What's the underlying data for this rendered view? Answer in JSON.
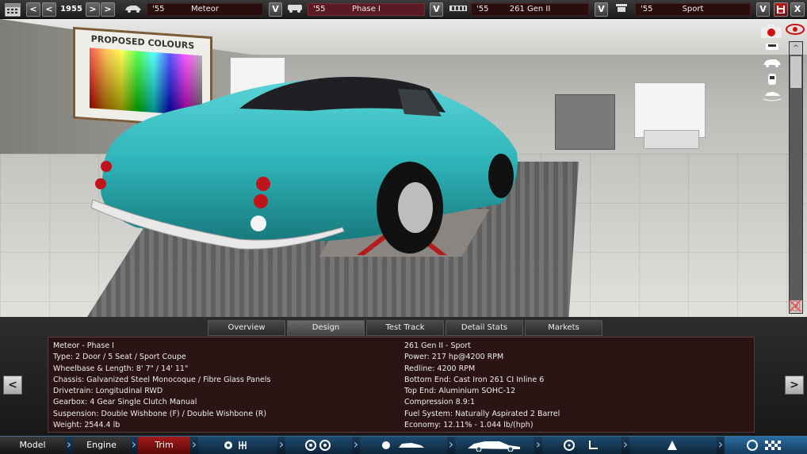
{
  "topbar": {
    "year": "1955",
    "prev_fast": "<",
    "prev": "<",
    "next": ">",
    "next_fast": ">",
    "selectors": [
      {
        "year": "'55",
        "name": "Meteor",
        "button": "V",
        "icon": "car-model-icon"
      },
      {
        "year": "'55",
        "name": "Phase I",
        "button": "V",
        "icon": "car-trim-icon"
      },
      {
        "year": "'55",
        "name": "261 Gen II",
        "button": "V",
        "icon": "engine-icon"
      },
      {
        "year": "'55",
        "name": "Sport",
        "button": "V",
        "icon": "trim-icon"
      }
    ],
    "save": "save-icon",
    "close": "X"
  },
  "scene": {
    "poster_title": "PROPOSED COLOURS",
    "car_color": "#2fb5b9",
    "scroll_up": "^",
    "scroll_down": "v"
  },
  "tabs": [
    {
      "label": "Overview",
      "active": false
    },
    {
      "label": "Design",
      "active": true
    },
    {
      "label": "Test Track",
      "active": false
    },
    {
      "label": "Detail Stats",
      "active": false
    },
    {
      "label": "Markets",
      "active": false
    }
  ],
  "info": {
    "left": [
      "Meteor - Phase I",
      "Type: 2 Door / 5 Seat / Sport Coupe",
      "Wheelbase & Length: 8' 7\" / 14' 11\"",
      "Chassis: Galvanized Steel Monocoque / Fibre Glass Panels",
      "Drivetrain: Longitudinal RWD",
      "Gearbox: 4 Gear Single Clutch Manual",
      "Suspension: Double Wishbone (F) / Double Wishbone (R)",
      "Weight: 2544.4 lb"
    ],
    "right": [
      "261 Gen II - Sport",
      "Power: 217 hp@4200 RPM",
      "Redline: 4200 RPM",
      "Bottom End: Cast Iron 261 CI Inline 6",
      "Top End: Aluminium SOHC-12",
      "Compression 8.9:1",
      "Fuel System: Naturally Aspirated 2 Barrel",
      "Economy: 12.11% - 1.044 lb/(hph)"
    ],
    "prev": "<",
    "next": ">"
  },
  "nav": {
    "model": "Model",
    "engine": "Engine",
    "trim": "Trim"
  }
}
